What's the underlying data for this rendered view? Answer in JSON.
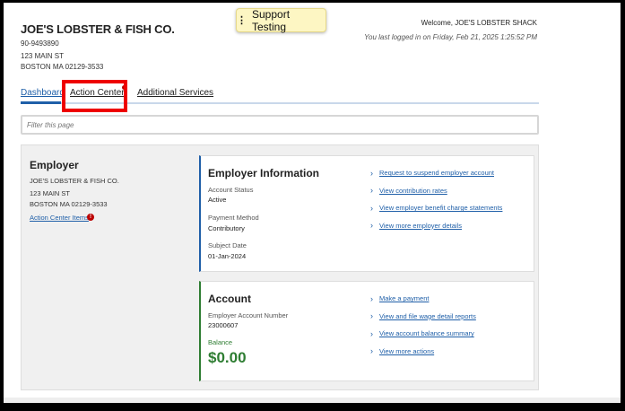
{
  "employer": {
    "name": "JOE'S LOBSTER & FISH CO.",
    "id": "90-9493890",
    "address1": "123 MAIN ST",
    "address2": "BOSTON MA 02129-3533"
  },
  "support": {
    "label": "Support Testing"
  },
  "session": {
    "welcome": "Welcome, JOE'S LOBSTER SHACK",
    "last_login": "You last logged in on Friday, Feb 21, 2025 1:25:52 PM"
  },
  "tabs": [
    {
      "label": "Dashboard",
      "active": true
    },
    {
      "label": "Action Center"
    },
    {
      "label": "Additional Services"
    }
  ],
  "filter": {
    "placeholder": "Filter this page"
  },
  "panel": {
    "title": "Employer",
    "name": "JOE'S LOBSTER & FISH CO.",
    "address1": "123 MAIN ST",
    "address2": "BOSTON MA 02129-3533",
    "action_link": "Action Center Items",
    "action_badge": "!"
  },
  "employer_info": {
    "title": "Employer Information",
    "status_label": "Account Status",
    "status_value": "Active",
    "payment_label": "Payment Method",
    "payment_value": "Contributory",
    "subject_label": "Subject Date",
    "subject_value": "01-Jan-2024",
    "links": [
      "Request to suspend employer account",
      "View contribution rates",
      "View employer benefit charge statements",
      "View more employer details"
    ]
  },
  "account": {
    "title": "Account",
    "number_label": "Employer Account Number",
    "number_value": "23000607",
    "balance_label": "Balance",
    "balance_value": "$0.00",
    "links": [
      "Make a payment",
      "View and file wage detail reports",
      "View account balance summary",
      "View more actions"
    ]
  },
  "colors": {
    "link": "#1f5fa8",
    "balance": "#2e7d32",
    "highlight": "#e00000",
    "support_bg": "#fdf6c3"
  }
}
